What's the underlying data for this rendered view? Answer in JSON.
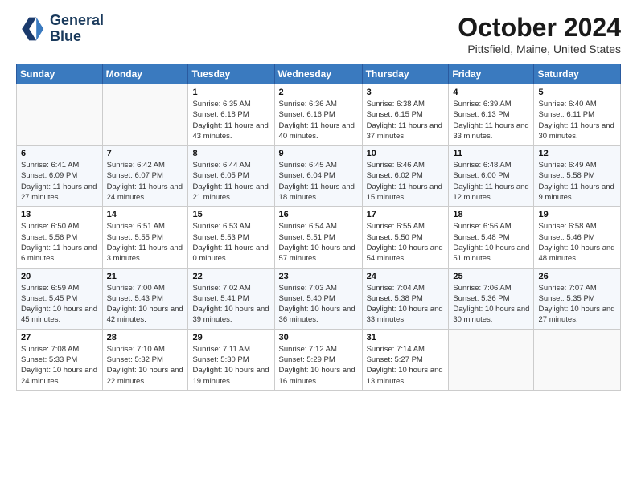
{
  "logo": {
    "line1": "General",
    "line2": "Blue"
  },
  "title": "October 2024",
  "location": "Pittsfield, Maine, United States",
  "days_of_week": [
    "Sunday",
    "Monday",
    "Tuesday",
    "Wednesday",
    "Thursday",
    "Friday",
    "Saturday"
  ],
  "weeks": [
    [
      {
        "day": "",
        "info": ""
      },
      {
        "day": "",
        "info": ""
      },
      {
        "day": "1",
        "info": "Sunrise: 6:35 AM\nSunset: 6:18 PM\nDaylight: 11 hours and 43 minutes."
      },
      {
        "day": "2",
        "info": "Sunrise: 6:36 AM\nSunset: 6:16 PM\nDaylight: 11 hours and 40 minutes."
      },
      {
        "day": "3",
        "info": "Sunrise: 6:38 AM\nSunset: 6:15 PM\nDaylight: 11 hours and 37 minutes."
      },
      {
        "day": "4",
        "info": "Sunrise: 6:39 AM\nSunset: 6:13 PM\nDaylight: 11 hours and 33 minutes."
      },
      {
        "day": "5",
        "info": "Sunrise: 6:40 AM\nSunset: 6:11 PM\nDaylight: 11 hours and 30 minutes."
      }
    ],
    [
      {
        "day": "6",
        "info": "Sunrise: 6:41 AM\nSunset: 6:09 PM\nDaylight: 11 hours and 27 minutes."
      },
      {
        "day": "7",
        "info": "Sunrise: 6:42 AM\nSunset: 6:07 PM\nDaylight: 11 hours and 24 minutes."
      },
      {
        "day": "8",
        "info": "Sunrise: 6:44 AM\nSunset: 6:05 PM\nDaylight: 11 hours and 21 minutes."
      },
      {
        "day": "9",
        "info": "Sunrise: 6:45 AM\nSunset: 6:04 PM\nDaylight: 11 hours and 18 minutes."
      },
      {
        "day": "10",
        "info": "Sunrise: 6:46 AM\nSunset: 6:02 PM\nDaylight: 11 hours and 15 minutes."
      },
      {
        "day": "11",
        "info": "Sunrise: 6:48 AM\nSunset: 6:00 PM\nDaylight: 11 hours and 12 minutes."
      },
      {
        "day": "12",
        "info": "Sunrise: 6:49 AM\nSunset: 5:58 PM\nDaylight: 11 hours and 9 minutes."
      }
    ],
    [
      {
        "day": "13",
        "info": "Sunrise: 6:50 AM\nSunset: 5:56 PM\nDaylight: 11 hours and 6 minutes."
      },
      {
        "day": "14",
        "info": "Sunrise: 6:51 AM\nSunset: 5:55 PM\nDaylight: 11 hours and 3 minutes."
      },
      {
        "day": "15",
        "info": "Sunrise: 6:53 AM\nSunset: 5:53 PM\nDaylight: 11 hours and 0 minutes."
      },
      {
        "day": "16",
        "info": "Sunrise: 6:54 AM\nSunset: 5:51 PM\nDaylight: 10 hours and 57 minutes."
      },
      {
        "day": "17",
        "info": "Sunrise: 6:55 AM\nSunset: 5:50 PM\nDaylight: 10 hours and 54 minutes."
      },
      {
        "day": "18",
        "info": "Sunrise: 6:56 AM\nSunset: 5:48 PM\nDaylight: 10 hours and 51 minutes."
      },
      {
        "day": "19",
        "info": "Sunrise: 6:58 AM\nSunset: 5:46 PM\nDaylight: 10 hours and 48 minutes."
      }
    ],
    [
      {
        "day": "20",
        "info": "Sunrise: 6:59 AM\nSunset: 5:45 PM\nDaylight: 10 hours and 45 minutes."
      },
      {
        "day": "21",
        "info": "Sunrise: 7:00 AM\nSunset: 5:43 PM\nDaylight: 10 hours and 42 minutes."
      },
      {
        "day": "22",
        "info": "Sunrise: 7:02 AM\nSunset: 5:41 PM\nDaylight: 10 hours and 39 minutes."
      },
      {
        "day": "23",
        "info": "Sunrise: 7:03 AM\nSunset: 5:40 PM\nDaylight: 10 hours and 36 minutes."
      },
      {
        "day": "24",
        "info": "Sunrise: 7:04 AM\nSunset: 5:38 PM\nDaylight: 10 hours and 33 minutes."
      },
      {
        "day": "25",
        "info": "Sunrise: 7:06 AM\nSunset: 5:36 PM\nDaylight: 10 hours and 30 minutes."
      },
      {
        "day": "26",
        "info": "Sunrise: 7:07 AM\nSunset: 5:35 PM\nDaylight: 10 hours and 27 minutes."
      }
    ],
    [
      {
        "day": "27",
        "info": "Sunrise: 7:08 AM\nSunset: 5:33 PM\nDaylight: 10 hours and 24 minutes."
      },
      {
        "day": "28",
        "info": "Sunrise: 7:10 AM\nSunset: 5:32 PM\nDaylight: 10 hours and 22 minutes."
      },
      {
        "day": "29",
        "info": "Sunrise: 7:11 AM\nSunset: 5:30 PM\nDaylight: 10 hours and 19 minutes."
      },
      {
        "day": "30",
        "info": "Sunrise: 7:12 AM\nSunset: 5:29 PM\nDaylight: 10 hours and 16 minutes."
      },
      {
        "day": "31",
        "info": "Sunrise: 7:14 AM\nSunset: 5:27 PM\nDaylight: 10 hours and 13 minutes."
      },
      {
        "day": "",
        "info": ""
      },
      {
        "day": "",
        "info": ""
      }
    ]
  ]
}
